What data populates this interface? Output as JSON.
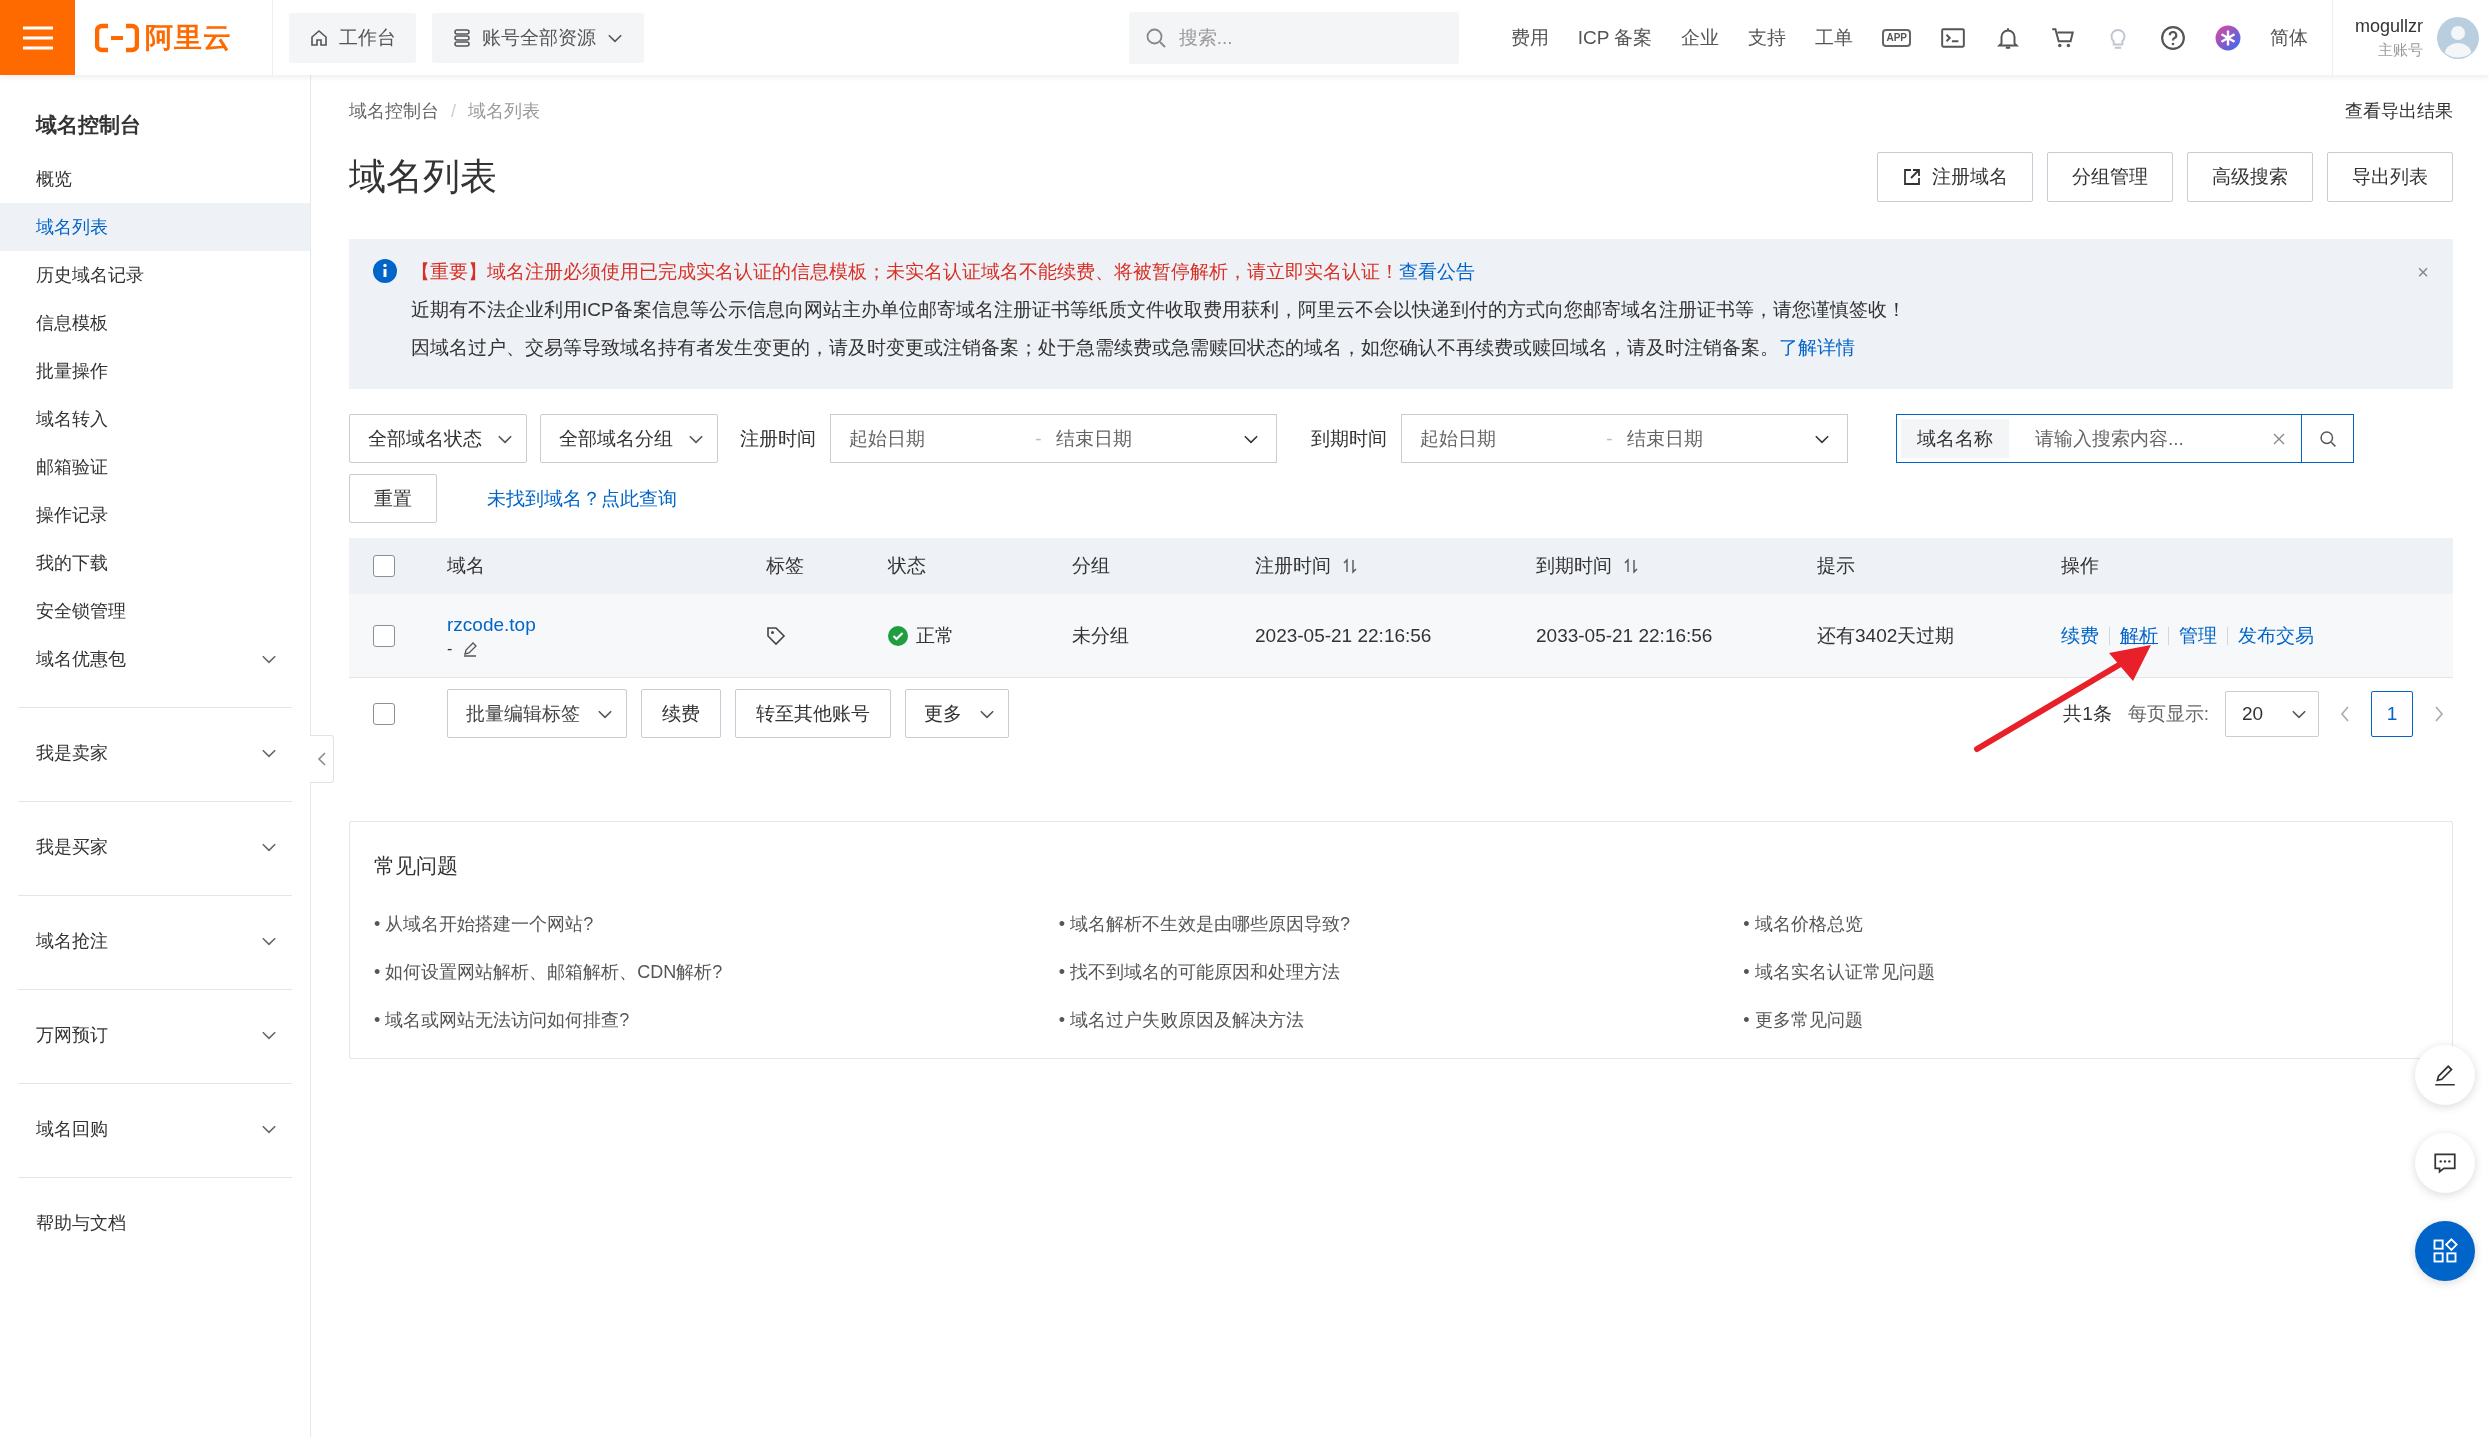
{
  "topbar": {
    "brand": "阿里云",
    "workbench": "工作台",
    "resources": "账号全部资源",
    "search": {
      "placeholder": "搜索..."
    },
    "links": [
      "费用",
      "ICP 备案",
      "企业",
      "支持",
      "工单"
    ],
    "app_badge": "APP",
    "language": "简体",
    "user": {
      "name": "mogullzr",
      "role": "主账号"
    }
  },
  "sidebar": {
    "title": "域名控制台",
    "items": [
      {
        "label": "概览",
        "selected": false
      },
      {
        "label": "域名列表",
        "selected": true
      },
      {
        "label": "历史域名记录",
        "selected": false
      },
      {
        "label": "信息模板",
        "selected": false
      },
      {
        "label": "批量操作",
        "selected": false
      },
      {
        "label": "域名转入",
        "selected": false
      },
      {
        "label": "邮箱验证",
        "selected": false
      },
      {
        "label": "操作记录",
        "selected": false
      },
      {
        "label": "我的下载",
        "selected": false
      },
      {
        "label": "安全锁管理",
        "selected": false
      }
    ],
    "sections": [
      {
        "label": "域名优惠包",
        "expanded": false
      },
      {
        "label": "我是卖家",
        "expanded": false
      },
      {
        "label": "我是买家",
        "expanded": false
      },
      {
        "label": "域名抢注",
        "expanded": false
      },
      {
        "label": "万网预订",
        "expanded": false
      },
      {
        "label": "域名回购",
        "expanded": false
      }
    ],
    "help": "帮助与文档"
  },
  "breadcrumb": [
    "域名控制台",
    "域名列表"
  ],
  "breadcrumb_separator": "/",
  "export_results": "查看导出结果",
  "title": "域名列表",
  "header_buttons": [
    {
      "label": "注册域名",
      "kind": "external"
    },
    {
      "label": "分组管理",
      "kind": "plain"
    },
    {
      "label": "高级搜索",
      "kind": "plain"
    },
    {
      "label": "导出列表",
      "kind": "plain"
    }
  ],
  "notice": {
    "important": "【重要】域名注册必须使用已完成实名认证的信息模板；未实名认证域名不能续费、将被暂停解析，请立即实名认证！",
    "important_link": "查看公告",
    "lines": [
      {
        "text": "近期有不法企业利用ICP备案信息等公示信息向网站主办单位邮寄域名注册证书等纸质文件收取费用获利，阿里云不会以快递到付的方式向您邮寄域名注册证书等，请您谨慎签收！"
      },
      {
        "text": "因域名过户、交易等导致域名持有者发生变更的，请及时变更或注销备案；处于急需续费或急需赎回状态的域名，如您确认不再续费或赎回域名，请及时注销备案。",
        "link": "了解详情"
      }
    ],
    "close": "×"
  },
  "filters": {
    "status": "全部域名状态",
    "group": "全部域名分组",
    "ranges": [
      {
        "label": "注册时间",
        "start_placeholder": "起始日期",
        "separator": "-",
        "end_placeholder": "结束日期"
      },
      {
        "label": "到期时间",
        "start_placeholder": "起始日期",
        "separator": "-",
        "end_placeholder": "结束日期"
      }
    ],
    "search": {
      "category": "域名名称",
      "placeholder": "请输入搜索内容..."
    },
    "reset": "重置",
    "lookup_link": "未找到域名？点此查询"
  },
  "table": {
    "all_selected": false,
    "columns": [
      {
        "label": "域名",
        "sortable": false
      },
      {
        "label": "标签",
        "sortable": false
      },
      {
        "label": "状态",
        "sortable": false
      },
      {
        "label": "分组",
        "sortable": false
      },
      {
        "label": "注册时间",
        "sortable": true
      },
      {
        "label": "到期时间",
        "sortable": true
      },
      {
        "label": "提示",
        "sortable": false
      },
      {
        "label": "操作",
        "sortable": false
      }
    ],
    "rows": [
      {
        "selected": false,
        "domain": "rzcode.top",
        "remark": "-",
        "status": {
          "label": "正常",
          "kind": "ok"
        },
        "group": "未分组",
        "registered": "2023-05-21 22:16:56",
        "expires": "2033-05-21 22:16:56",
        "hint": "还有3402天过期",
        "actions": [
          {
            "label": "续费",
            "hovered": false
          },
          {
            "label": "解析",
            "hovered": true
          },
          {
            "label": "管理",
            "hovered": false
          },
          {
            "label": "发布交易",
            "hovered": false
          }
        ]
      }
    ]
  },
  "bulk": {
    "selected": false,
    "tag_select": "批量编辑标签",
    "buttons": [
      "续费",
      "转至其他账号"
    ],
    "more": "更多"
  },
  "pagination": {
    "total": "共1条",
    "page_size_label": "每页显示:",
    "page_size": "20",
    "pages": [
      {
        "label": "1",
        "selected": true
      }
    ]
  },
  "faq": {
    "title": "常见问题",
    "items": [
      "• 从域名开始搭建一个网站?",
      "• 域名解析不生效是由哪些原因导致?",
      "• 域名价格总览",
      "• 如何设置网站解析、邮箱解析、CDN解析?",
      "• 找不到域名的可能原因和处理方法",
      "• 域名实名认证常见问题",
      "• 域名或网站无法访问如何排查?",
      "• 域名过户失败原因及解决方法",
      "• 更多常见问题"
    ]
  }
}
